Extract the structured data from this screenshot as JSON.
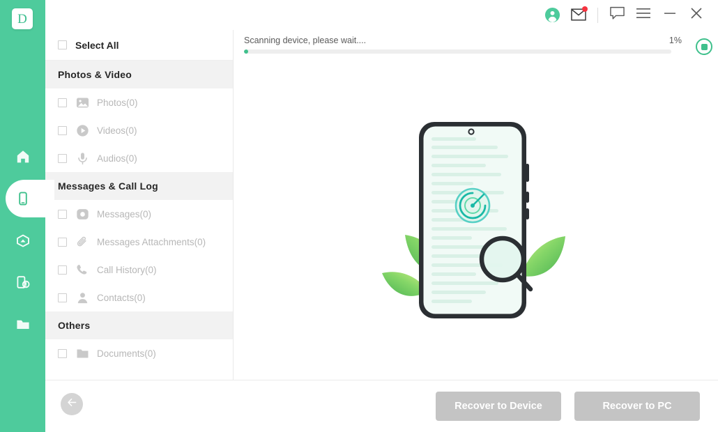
{
  "brand": {
    "logo_letter": "D",
    "rail_color": "#4ecb9c",
    "accent_color": "#3fc08c",
    "badge_color": "#f5333f"
  },
  "rail": {
    "items": [
      {
        "name": "home-icon",
        "label": "Home",
        "active": false
      },
      {
        "name": "phone-icon",
        "label": "Device Recovery",
        "active": true
      },
      {
        "name": "cloud-icon",
        "label": "Cloud Recovery",
        "active": false
      },
      {
        "name": "device-repair-icon",
        "label": "System Repair",
        "active": false
      },
      {
        "name": "folder-icon",
        "label": "Files",
        "active": false
      }
    ]
  },
  "titlebar": {
    "buttons": [
      {
        "name": "account-avatar",
        "label": "Account"
      },
      {
        "name": "mail-icon",
        "label": "Messages",
        "badge": true
      },
      {
        "name": "feedback-icon",
        "label": "Feedback"
      },
      {
        "name": "menu-icon",
        "label": "Menu"
      },
      {
        "name": "minimize-icon",
        "label": "Minimize"
      },
      {
        "name": "close-icon",
        "label": "Close"
      }
    ]
  },
  "sidebar": {
    "select_all_label": "Select All",
    "select_all_checked": false,
    "groups": [
      {
        "title": "Photos & Video",
        "items": [
          {
            "icon": "photo-icon",
            "label": "Photos(0)",
            "checked": false
          },
          {
            "icon": "video-icon",
            "label": "Videos(0)",
            "checked": false
          },
          {
            "icon": "audio-icon",
            "label": "Audios(0)",
            "checked": false
          }
        ]
      },
      {
        "title": "Messages & Call Log",
        "items": [
          {
            "icon": "message-icon",
            "label": "Messages(0)",
            "checked": false
          },
          {
            "icon": "attachment-icon",
            "label": "Messages Attachments(0)",
            "checked": false
          },
          {
            "icon": "call-icon",
            "label": "Call History(0)",
            "checked": false
          },
          {
            "icon": "contact-icon",
            "label": "Contacts(0)",
            "checked": false
          }
        ]
      },
      {
        "title": "Others",
        "items": [
          {
            "icon": "document-icon",
            "label": "Documents(0)",
            "checked": false
          }
        ]
      }
    ]
  },
  "main": {
    "scan_status": "Scanning device, please wait....",
    "scan_percent_label": "1%",
    "scan_percent_value": 1,
    "stop_button_label": "Stop Scan",
    "illustration": "phone-scanning-with-magnifier-and-leaves"
  },
  "bottombar": {
    "back_label": "Back",
    "recover_to_device_label": "Recover to Device",
    "recover_to_pc_label": "Recover to PC"
  }
}
